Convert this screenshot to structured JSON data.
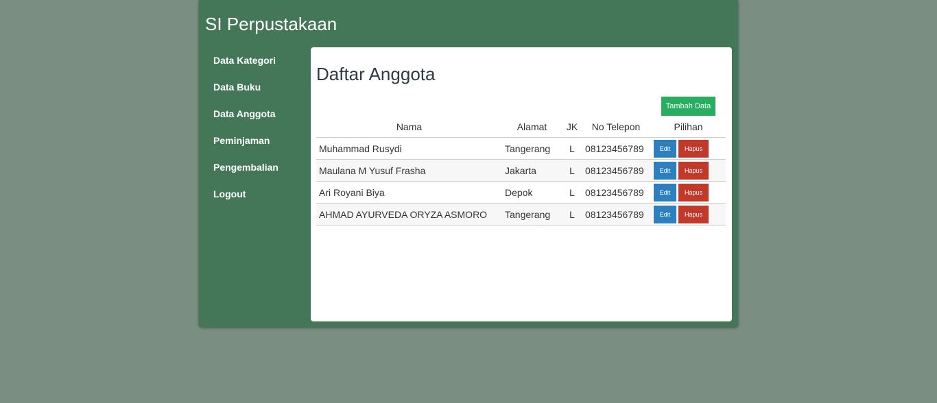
{
  "app": {
    "title": "SI Perpustakaan"
  },
  "sidebar": {
    "items": [
      {
        "label": "Data Kategori"
      },
      {
        "label": "Data Buku"
      },
      {
        "label": "Data Anggota"
      },
      {
        "label": "Peminjaman"
      },
      {
        "label": "Pengembalian"
      },
      {
        "label": "Logout"
      }
    ]
  },
  "main": {
    "title": "Daftar Anggota",
    "add_button": "Tambah Data",
    "columns": [
      "Nama",
      "Alamat",
      "JK",
      "No Telepon",
      "Pilihan"
    ],
    "rows": [
      {
        "nama": "Muhammad Rusydi",
        "alamat": "Tangerang",
        "jk": "L",
        "telp": "08123456789"
      },
      {
        "nama": "Maulana M Yusuf Frasha",
        "alamat": "Jakarta",
        "jk": "L",
        "telp": "08123456789"
      },
      {
        "nama": "Ari Royani Biya",
        "alamat": "Depok",
        "jk": "L",
        "telp": "08123456789"
      },
      {
        "nama": "AHMAD AYURVEDA ORYZA ASMORO",
        "alamat": "Tangerang",
        "jk": "L",
        "telp": "08123456789"
      }
    ],
    "edit_label": "Edit",
    "delete_label": "Hapus"
  },
  "colors": {
    "background": "#7a8f82",
    "frame": "#437758",
    "add_button": "#27ae60",
    "edit_button": "#2d80bd",
    "delete_button": "#c0392b"
  }
}
